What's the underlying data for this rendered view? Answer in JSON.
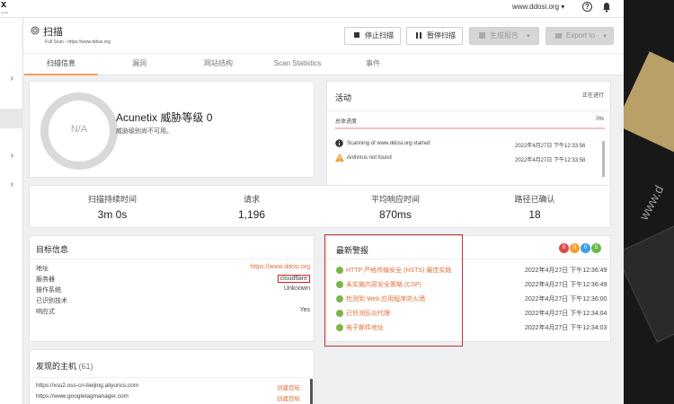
{
  "app": {
    "logo": "x",
    "logo_sub": "unetix"
  },
  "topbar": {
    "host": "www.ddosi.org ▾",
    "help": "?"
  },
  "sidebar": {
    "items": [
      "›",
      "",
      "›",
      "›"
    ]
  },
  "header": {
    "title": "扫描",
    "subtitle": "Full Scan - https://www.ddosi.org",
    "buttons": {
      "stop": "停止扫描",
      "pause": "暂停扫描",
      "report": "生成报告",
      "export": "Export to"
    }
  },
  "tabs": [
    "扫描信息",
    "漏洞",
    "网站结构",
    "Scan Statistics",
    "事件"
  ],
  "threat": {
    "gauge": "N/A",
    "title": "Acunetix 威胁等级 0",
    "desc": "威胁级别尚不可用。"
  },
  "activity": {
    "title": "活动",
    "status": "正在进行",
    "progress_label": "总体进度",
    "progress_value": "0%",
    "progress": 0,
    "logs": [
      {
        "icon": "info-icon",
        "message": "Scanning of www.ddosi.org started",
        "time": "2022年4月27日 下午12:33:56"
      },
      {
        "icon": "warning-icon",
        "message": "Antivirus not found",
        "time": "2022年4月27日 下午12:33:58"
      }
    ]
  },
  "stats": [
    {
      "label": "扫描持续时间",
      "value": "3m 0s"
    },
    {
      "label": "请求",
      "value": "1,196"
    },
    {
      "label": "平均响应时间",
      "value": "870ms"
    },
    {
      "label": "路径已确认",
      "value": "18"
    }
  ],
  "target": {
    "title": "目标信息",
    "rows": [
      {
        "label": "地址",
        "value": "https://www.ddosi.org"
      },
      {
        "label": "服务器",
        "value": "cloudflare"
      },
      {
        "label": "操作系统",
        "value": "Unknown"
      },
      {
        "label": "已识别技术",
        "value": ""
      },
      {
        "label": "响应式",
        "value": "Yes"
      }
    ]
  },
  "alerts": {
    "title": "最新警报",
    "badges": [
      {
        "count": "0",
        "color": "#e04848"
      },
      {
        "count": "0",
        "color": "#f0a030"
      },
      {
        "count": "0",
        "color": "#3aa0e0"
      },
      {
        "count": "5",
        "color": "#6cb84a"
      }
    ],
    "items": [
      {
        "name": "HTTP 严格传输安全 (HSTS) 最佳实践",
        "time": "2022年4月27日 下午12:36:49"
      },
      {
        "name": "未实施内容安全策略 (CSP)",
        "time": "2022年4月27日 下午12:36:49"
      },
      {
        "name": "检测到 Web 应用程序防火墙",
        "time": "2022年4月27日 下午12:36:00"
      },
      {
        "name": "已侦测反向代理",
        "time": "2022年4月27日 下午12:34:04"
      },
      {
        "name": "电子邮件地址",
        "time": "2022年4月27日 下午12:34:03"
      }
    ]
  },
  "hosts": {
    "title": "发现的主机",
    "count": "(61)",
    "rows": [
      {
        "host": "https://xss2.oss-cn-beijing.aliyuncs.com",
        "action": "创建目标"
      },
      {
        "host": "https://www.googletagmanager.com",
        "action": "创建目标"
      }
    ]
  },
  "watermark": "www.d"
}
